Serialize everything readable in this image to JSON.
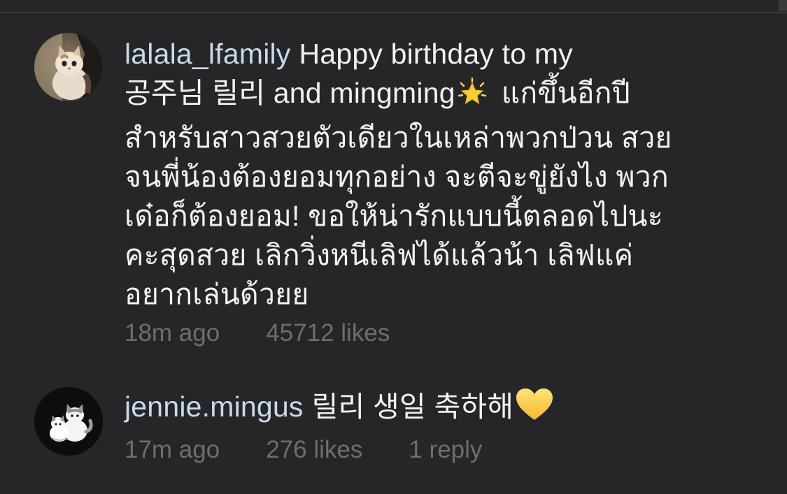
{
  "comments": [
    {
      "username": "lalala_lfamily",
      "lines": [
        "Happy birthday to my",
        "공주님 릴리 and mingming",
        "แก่ขึ้นอีกปี",
        "สำหรับสาวสวยตัวเดียวในเหล่าพวกป่วน สวย",
        "จนพี่น้องต้องยอมทุกอย่าง จะตีจะขู่ยังไง พวก",
        "เด๋อก็ต้องยอม! ขอให้น่ารักแบบนี้ตลอดไปนะ",
        "คะสุดสวย เลิกวิ่งหนีเลิฟได้แล้วน้า เลิฟแค่",
        "อยากเล่นด้วยย"
      ],
      "emoji": "glowing-star-icon",
      "time": "18m ago",
      "likes": "45712 likes"
    },
    {
      "username": "jennie.mingus",
      "lines": [
        "릴리 생일 축하해"
      ],
      "emoji": "yellow-heart-icon",
      "time": "17m ago",
      "likes": "276 likes",
      "replies": "1 reply"
    }
  ],
  "colors": {
    "background": "#262628",
    "username": "#c9d9ee",
    "text": "#f2f2f2",
    "meta": "#6e6e72"
  }
}
